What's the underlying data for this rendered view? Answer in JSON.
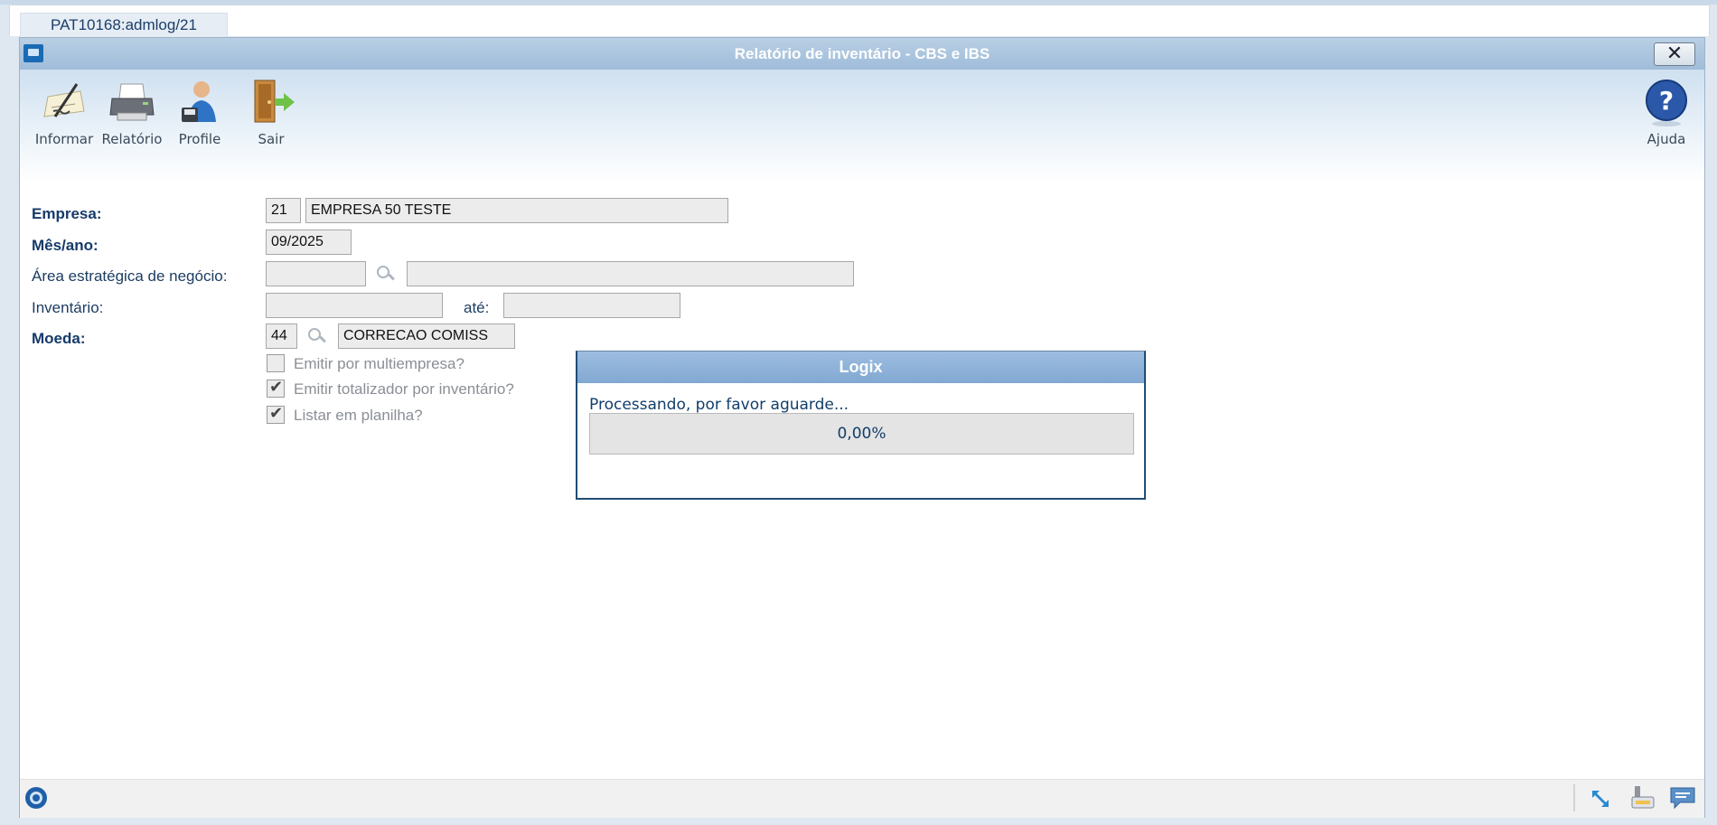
{
  "tab": {
    "label": "PAT10168:admlog/21"
  },
  "window": {
    "title": "Relatório de inventário - CBS e IBS",
    "close_glyph": "✕"
  },
  "toolbar": {
    "informar": "Informar",
    "relatorio": "Relatório",
    "profile": "Profile",
    "sair": "Sair",
    "ajuda": "Ajuda"
  },
  "form": {
    "empresa_label": "Empresa:",
    "empresa_code": "21",
    "empresa_name": "EMPRESA 50 TESTE",
    "mes_ano_label": "Mês/ano:",
    "mes_ano": "09/2025",
    "area_label": "Área estratégica de negócio:",
    "area_code": "",
    "area_desc": "",
    "inventario_label": "Inventário:",
    "inventario_de": "",
    "ate_label": "até:",
    "inventario_ate": "",
    "moeda_label": "Moeda:",
    "moeda_code": "44",
    "moeda_desc": "CORRECAO COMISS",
    "chk_multiempresa": {
      "label": "Emitir por multiempresa?",
      "checked": false
    },
    "chk_totalizador": {
      "label": "Emitir totalizador por inventário?",
      "checked": true
    },
    "chk_planilha": {
      "label": "Listar em planilha?",
      "checked": true
    }
  },
  "dialog": {
    "title": "Logix",
    "message": "Processando, por favor aguarde...",
    "progress_text": "0,00%",
    "progress_fraction": 0
  },
  "colors": {
    "accent": "#1a6bb5",
    "label": "#163a6a",
    "titlebar": "#a9c4df"
  }
}
